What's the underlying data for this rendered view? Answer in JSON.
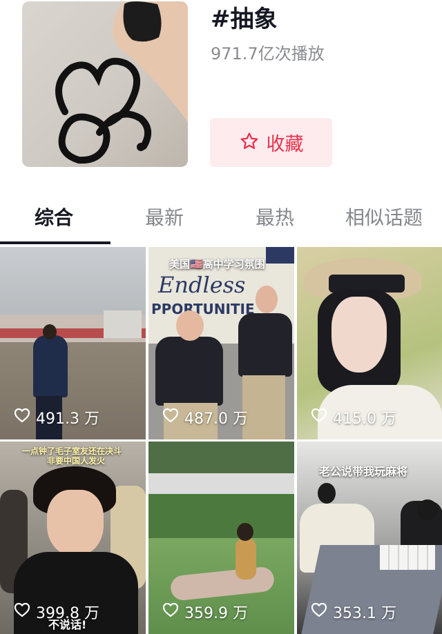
{
  "topic": {
    "title": "#抽象",
    "play_count": "971.7亿次播放",
    "favorite_label": "收藏"
  },
  "tabs": [
    {
      "label": "综合",
      "active": true
    },
    {
      "label": "最新",
      "active": false
    },
    {
      "label": "最热",
      "active": false
    },
    {
      "label": "相似话题",
      "active": false
    }
  ],
  "videos": [
    {
      "likes": "491.3 万",
      "caption": ""
    },
    {
      "likes": "487.0 万",
      "caption": "美国🇺🇸高中学习氛围",
      "sign_text": "Endless",
      "sign_text2": "PPORTUNITIE"
    },
    {
      "likes": "415.0 万",
      "caption": ""
    },
    {
      "likes": "399.8 万",
      "caption_line1": "一点钟了毛子室友还在决斗",
      "caption_line2": "非要中国人发火",
      "bottom_text": "不说话!"
    },
    {
      "likes": "359.9 万",
      "caption": ""
    },
    {
      "likes": "353.1 万",
      "caption": "老公说带我玩麻将"
    }
  ],
  "colors": {
    "accent": "#e8334c",
    "accent_bg": "#fdebee",
    "muted": "#8a8b91"
  }
}
